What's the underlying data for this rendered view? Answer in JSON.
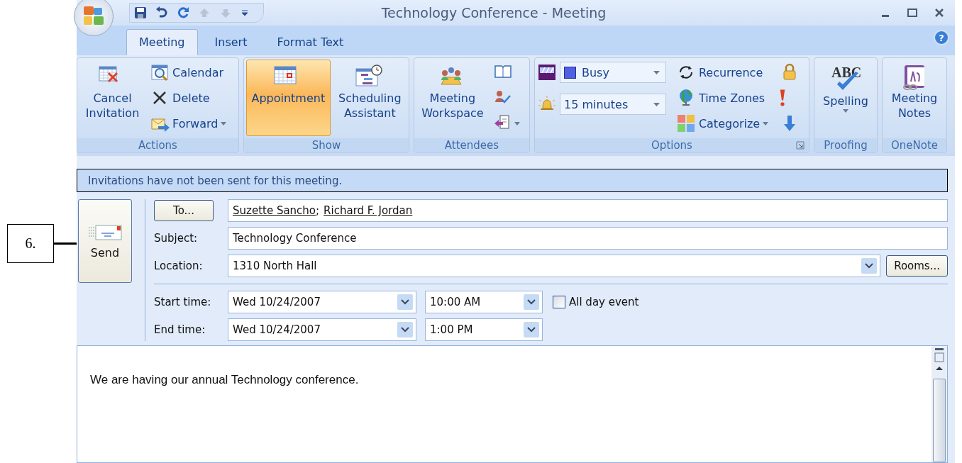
{
  "callout": {
    "label": "6."
  },
  "window": {
    "title": "Technology Conference - Meeting"
  },
  "tabs": [
    {
      "label": "Meeting",
      "selected": true
    },
    {
      "label": "Insert",
      "selected": false
    },
    {
      "label": "Format Text",
      "selected": false
    }
  ],
  "help": "?",
  "ribbon_groups": [
    {
      "label": "Actions",
      "buttons": [
        {
          "kind": "large",
          "label": "Cancel Invitation",
          "selected": false
        },
        {
          "kind": "small",
          "label": "Calendar"
        },
        {
          "kind": "small",
          "label": "Delete"
        },
        {
          "kind": "small",
          "label": "Forward",
          "dropdown": true
        }
      ]
    },
    {
      "label": "Show",
      "buttons": [
        {
          "kind": "large",
          "label": "Appointment",
          "selected": true
        },
        {
          "kind": "large",
          "label": "Scheduling Assistant",
          "selected": false
        }
      ]
    },
    {
      "label": "Attendees",
      "buttons": [
        {
          "kind": "large",
          "label": "Meeting Workspace",
          "selected": false
        },
        {
          "kind": "icon"
        },
        {
          "kind": "icon"
        },
        {
          "kind": "icon",
          "dropdown": true
        }
      ]
    },
    {
      "label": "Options",
      "launcher": true,
      "buttons": [
        {
          "kind": "select",
          "value": "Busy",
          "color": "#5060e0"
        },
        {
          "kind": "select",
          "value": "15 minutes"
        },
        {
          "kind": "small",
          "label": "Recurrence"
        },
        {
          "kind": "small",
          "label": "Time Zones"
        },
        {
          "kind": "small",
          "label": "Categorize",
          "dropdown": true
        },
        {
          "kind": "icon"
        },
        {
          "kind": "icon"
        },
        {
          "kind": "icon"
        }
      ]
    },
    {
      "label": "Proofing",
      "buttons": [
        {
          "kind": "large",
          "label": "Spelling",
          "icon_text": "ABC",
          "dropdown": true,
          "selected": false
        }
      ]
    },
    {
      "label": "OneNote",
      "buttons": [
        {
          "kind": "large",
          "label": "Meeting Notes",
          "selected": false
        }
      ]
    }
  ],
  "info_bar": "Invitations have not been sent for this meeting.",
  "send_button": "Send",
  "form": {
    "to_button": "To...",
    "recipients": [
      "Suzette Sancho",
      "Richard F. Jordan"
    ],
    "recipient_separator": ";",
    "subject_label": "Subject:",
    "subject": "Technology Conference",
    "location_label": "Location:",
    "location": "1310 North Hall",
    "rooms_button": "Rooms...",
    "start_label": "Start time:",
    "start_date": "Wed 10/24/2007",
    "start_time": "10:00 AM",
    "end_label": "End time:",
    "end_date": "Wed 10/24/2007",
    "end_time": "1:00 PM",
    "all_day": {
      "label": "All day event",
      "checked": false
    }
  },
  "body": "We are having our annual Technology conference."
}
